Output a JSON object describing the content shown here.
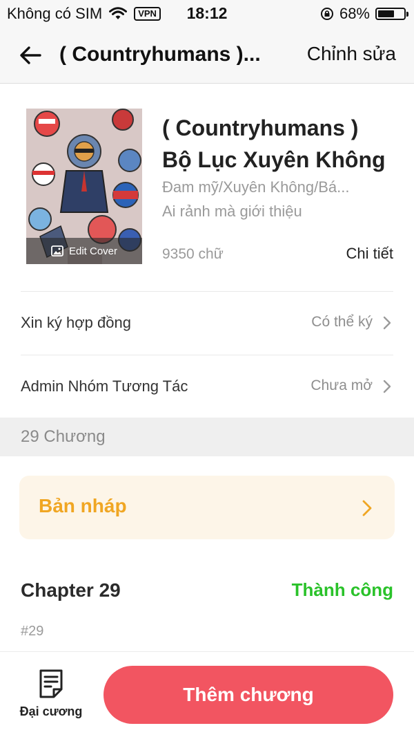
{
  "status_bar": {
    "carrier": "Không có SIM",
    "vpn": "VPN",
    "time": "18:12",
    "battery": "68%",
    "battery_level": 0.68
  },
  "nav": {
    "title": "( Countryhumans )...",
    "edit_label": "Chỉnh sửa"
  },
  "book": {
    "cover_label": "Edit Cover",
    "title_line1": "( Countryhumans )",
    "title_line2": "Bộ Lục Xuyên Không",
    "genre": "Đam mỹ/Xuyên Không/Bá...",
    "intro": "Ai rảnh mà giới thiệu",
    "word_count": "9350 chữ",
    "detail_label": "Chi tiết"
  },
  "settings": [
    {
      "label": "Xin ký hợp đồng",
      "value": "Có thể ký"
    },
    {
      "label": "Admin Nhóm Tương Tác",
      "value": "Chưa mở"
    }
  ],
  "chapters_header": "29 Chương",
  "draft_label": "Bản nháp",
  "chapter": {
    "title": "Chapter 29",
    "status": "Thành công",
    "number": "#29"
  },
  "bottom": {
    "outline_label": "Đại cương",
    "add_chapter_label": "Thêm chương"
  },
  "colors": {
    "accent": "#f25561",
    "draft": "#f0a623",
    "success": "#2ac22a"
  }
}
